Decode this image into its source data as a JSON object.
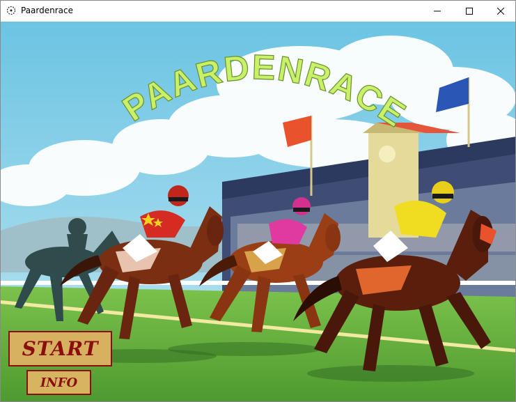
{
  "window": {
    "title": "Paardenrace",
    "icon": "app-icon",
    "controls": [
      "minimize-icon",
      "maximize-icon",
      "close-icon"
    ]
  },
  "game": {
    "logo_text": "PAARDENRACE",
    "start_label": "START",
    "info_label": "INFO"
  },
  "colors": {
    "logo": "#c8f06a",
    "button_text": "#8b0d0d",
    "button_bg": "#d7b15f",
    "sky": "#7cc9e6",
    "grass": "#5fae3c"
  }
}
